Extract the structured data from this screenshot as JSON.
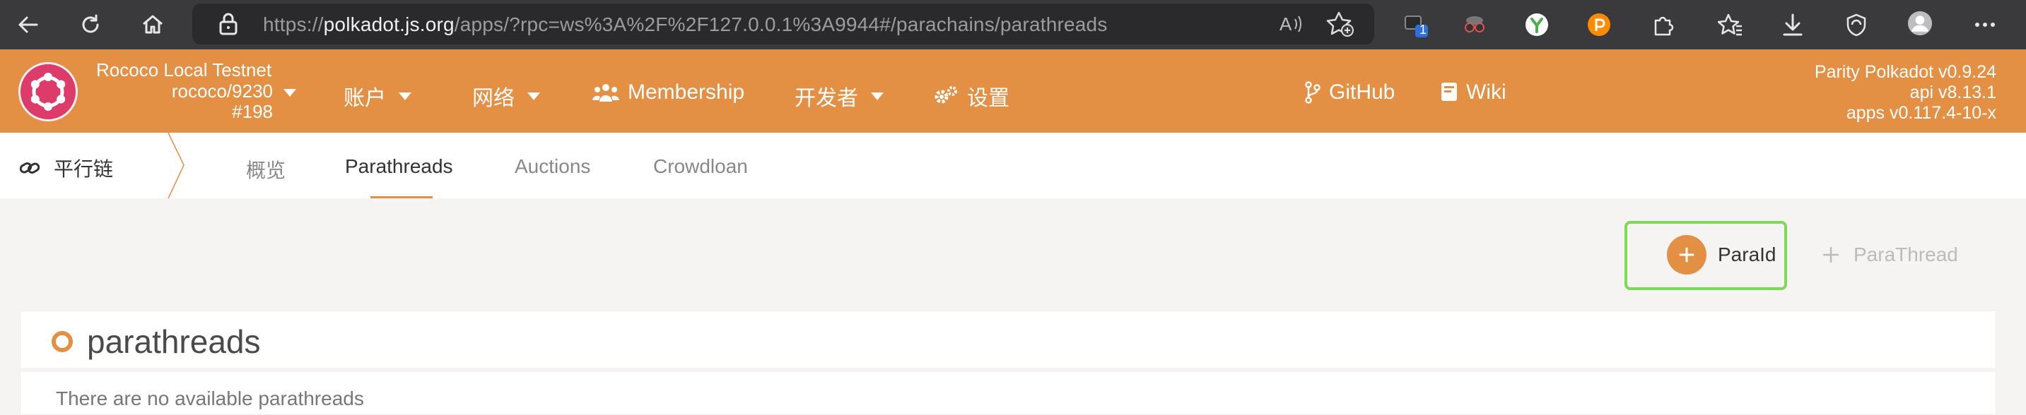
{
  "browser": {
    "url_prefix": "https://",
    "url_host": "polkadot.js.org",
    "url_path": "/apps/?rpc=ws%3A%2F%2F127.0.0.1%3A9944#/parachains/parathreads",
    "ext_badge": "1",
    "icons": [
      "back-icon",
      "refresh-icon",
      "home-icon",
      "lock-icon",
      "read-aloud-icon",
      "add-favorite-icon",
      "extension-icon",
      "spy-extension-icon",
      "y-extension-icon",
      "polkadot-extension-icon",
      "extensions-puzzle-icon",
      "favorites-icon",
      "downloads-icon",
      "browser-essentials-icon",
      "profile-icon",
      "more-icon"
    ]
  },
  "header": {
    "chain_name": "Rococo Local Testnet",
    "node": "rococo/9230",
    "block": "#198",
    "menu": [
      {
        "label": "账户",
        "has_dropdown": true
      },
      {
        "label": "网络",
        "has_dropdown": true
      },
      {
        "label": "Membership",
        "icon": "users-icon"
      },
      {
        "label": "开发者",
        "has_dropdown": true
      },
      {
        "label": "设置",
        "icon": "gears-icon"
      },
      {
        "label": "GitHub",
        "icon": "code-branch-icon"
      },
      {
        "label": "Wiki",
        "icon": "book-icon"
      }
    ],
    "version": {
      "runtime": "Parity Polkadot v0.9.24",
      "api": "api v8.13.1",
      "apps": "apps v0.117.4-10-x"
    },
    "accent_color": "#e38f44"
  },
  "subnav": {
    "section": "平行链",
    "tabs": [
      {
        "label": "概览",
        "active": false
      },
      {
        "label": "Parathreads",
        "active": true
      },
      {
        "label": "Auctions",
        "active": false
      },
      {
        "label": "Crowdloan",
        "active": false
      }
    ]
  },
  "actions": {
    "paraid_label": "ParaId",
    "parathread_label": "ParaThread"
  },
  "table": {
    "title": "parathreads",
    "empty_message": "There are no available parathreads"
  }
}
